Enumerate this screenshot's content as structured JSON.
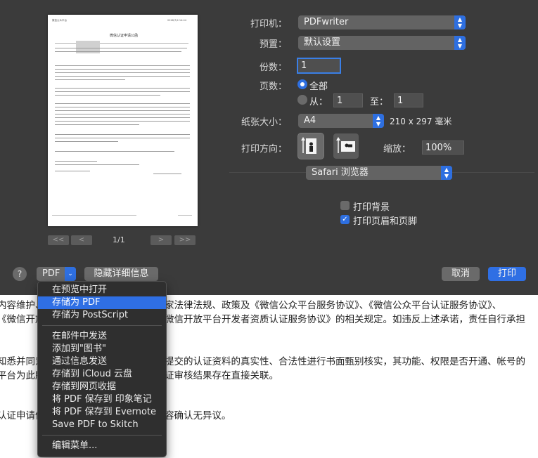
{
  "preview": {
    "doc_title": "微信认证申请公函",
    "page_indicator": "1/1",
    "nav": {
      "first": "<<",
      "prev": "<",
      "next": ">",
      "last": ">>"
    }
  },
  "settings": {
    "printer_label": "打印机：",
    "printer_value": "PDFwriter",
    "preset_label": "预置：",
    "preset_value": "默认设置",
    "copies_label": "份数：",
    "copies_value": "1",
    "pages_label": "页数：",
    "pages_all": "全部",
    "pages_from": "从：",
    "pages_from_value": "1",
    "pages_to": "至：",
    "pages_to_value": "1",
    "paper_label": "纸张大小：",
    "paper_value": "A4",
    "paper_dims": "210 x 297 毫米",
    "orientation_label": "打印方向：",
    "scale_label": "缩放：",
    "scale_value": "100%",
    "app_section": "Safari 浏览器",
    "print_backgrounds": "打印背景",
    "print_headers": "打印页眉和页脚"
  },
  "bottom": {
    "help": "?",
    "pdf_label": "PDF",
    "hide_details": "隐藏详细信息",
    "cancel": "取消",
    "print": "打印"
  },
  "pdf_menu": {
    "items": [
      "在预览中打开",
      "存储为 PDF",
      "存储为 PostScript",
      "在邮件中发送",
      "添加到\"图书\"",
      "通过信息发送",
      "存储到 iCloud 云盘",
      "存储到网页收据",
      "将 PDF 保存到 印象笔记",
      "将 PDF 保存到 Evernote",
      "Save PDF to Skitch",
      "编辑菜单..."
    ]
  },
  "background_text": {
    "line1a": "内容维护、",
    "line1b": "家法律法规、政策及《微信公众平台服务协议》、《微信公众平台认证服务协议》、",
    "line2a": "《微信开放",
    "line2b": "微信开放平台开发者资质认证服务协议》的相关规定。如违反上述承诺，责任自行承担",
    "line3a": "知悉并同意",
    "line3b": "提交的认证资料的真实性、合法性进行书面甄别核实，其功能、权限是否开通、帐号的",
    "line4a": "平台为此所",
    "line4b": "证审核结果存在直接关联。",
    "line5a": "认证申请信",
    "line5b": "容确认无异议。"
  }
}
